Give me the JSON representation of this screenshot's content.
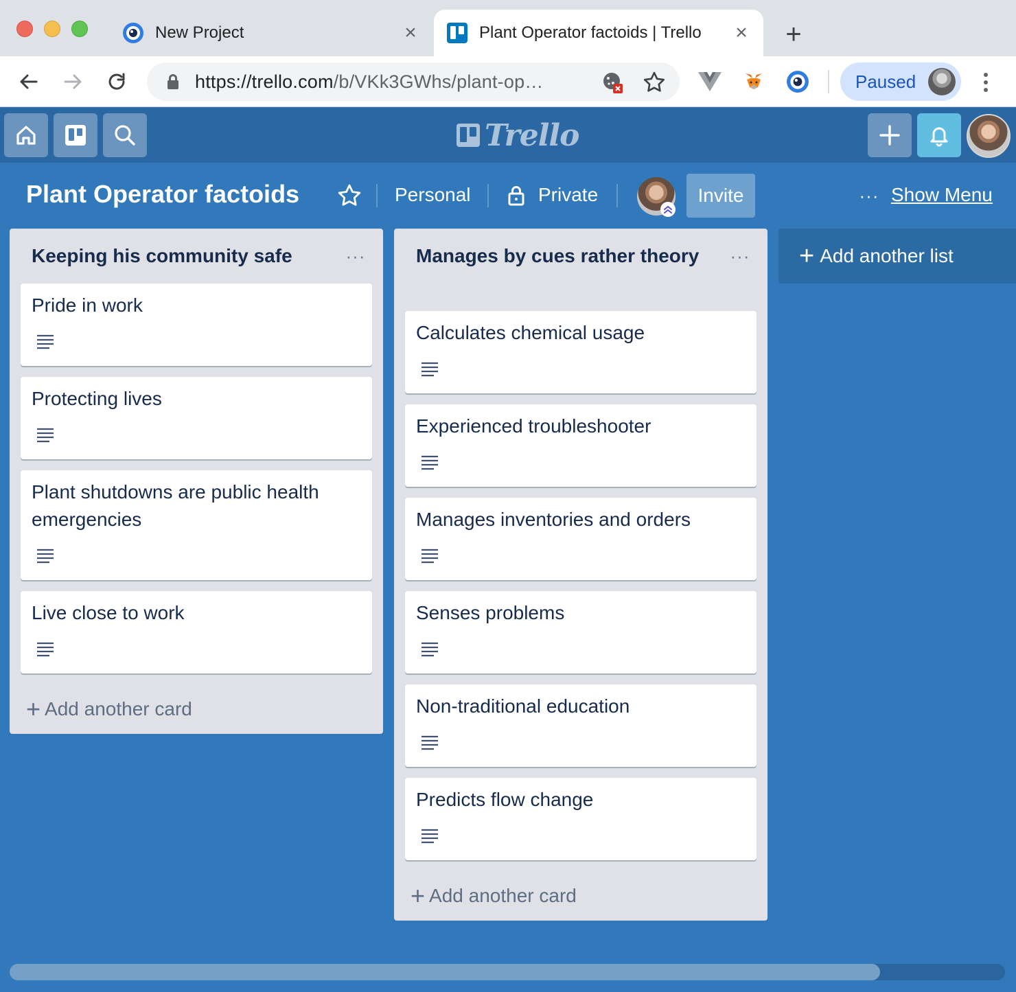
{
  "browser": {
    "tabs": [
      {
        "title": "New Project",
        "icon": "eye-icon",
        "active": false
      },
      {
        "title": "Plant Operator factoids | Trello",
        "icon": "trello-icon",
        "active": true
      }
    ],
    "url_host": "https://trello.com",
    "url_path": "/b/VKk3GWhs/plant-op…",
    "profile_label": "Paused"
  },
  "trello_header": {
    "logo_text": "Trello"
  },
  "board": {
    "title": "Plant Operator factoids",
    "team": "Personal",
    "visibility": "Private",
    "invite_label": "Invite",
    "more_label": "···",
    "show_menu_label": "Show Menu"
  },
  "lists": [
    {
      "title": "Keeping his community safe",
      "menu_label": "···",
      "cards": [
        {
          "title": "Pride in work",
          "has_description": true
        },
        {
          "title": "Protecting lives",
          "has_description": true
        },
        {
          "title": "Plant shutdowns are public health emergencies",
          "has_description": true
        },
        {
          "title": "Live close to work",
          "has_description": true
        }
      ],
      "add_card_label": "Add another card"
    },
    {
      "title": "Manages by cues rather theory",
      "menu_label": "···",
      "cards": [
        {
          "title": "Calculates chemical usage",
          "has_description": true
        },
        {
          "title": "Experienced troubleshooter",
          "has_description": true
        },
        {
          "title": "Manages inventories and orders",
          "has_description": true
        },
        {
          "title": "Senses problems",
          "has_description": true
        },
        {
          "title": "Non-traditional education",
          "has_description": true
        },
        {
          "title": "Predicts flow change",
          "has_description": true
        }
      ],
      "add_card_label": "Add another card"
    }
  ],
  "add_list_label": "Add another list",
  "colors": {
    "board_background": "#3179ba",
    "header_background": "#2b67a3",
    "list_background": "#dfe1e6",
    "notification_button": "#61bde2"
  }
}
